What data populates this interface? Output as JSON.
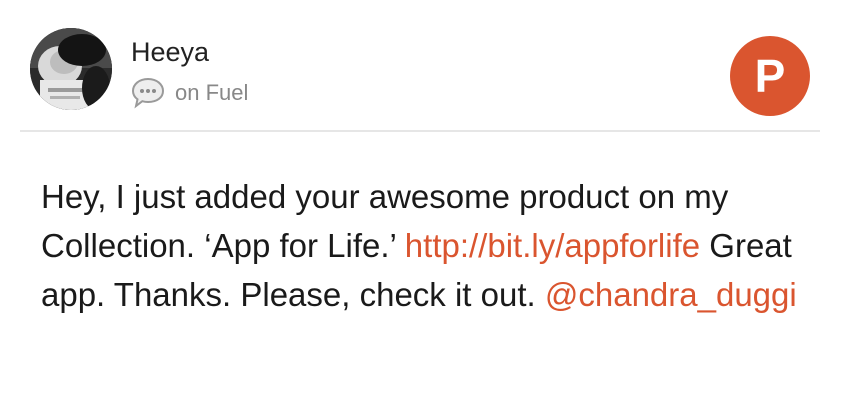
{
  "colors": {
    "accent": "#da552f",
    "name_text": "#222222",
    "muted_text": "#888888",
    "body_text": "#1a1a1a",
    "divider": "#e6e6e6"
  },
  "header": {
    "avatar_icon": "user-avatar-photo",
    "user_name": "Heeya",
    "source_icon": "chat-bubble-icon",
    "source_text": "on Fuel",
    "brand_letter": "P"
  },
  "message": {
    "text_before_link": "Hey, I just added your awesome product on my Collection. ‘App for Life.’ ",
    "link": "http://bit.ly/appforlife",
    "text_after_link": " Great app. Thanks. Please, check it out. ",
    "mention": "@chandra_duggi"
  }
}
